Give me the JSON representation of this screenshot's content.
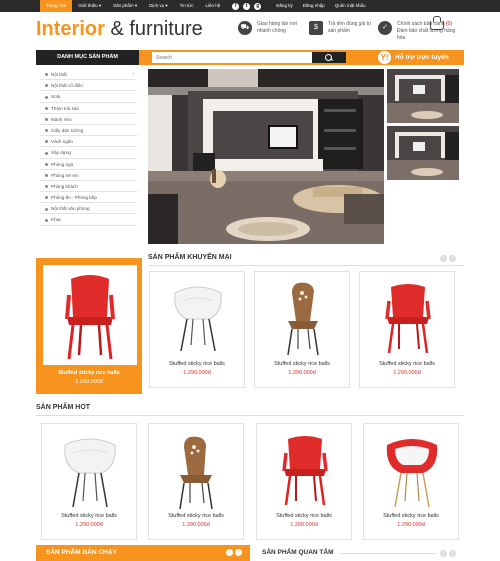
{
  "nav": {
    "items": [
      "Trang chủ",
      "Giới thiệu ▾",
      "Sản phẩm ▾",
      "Dịch vụ ▾",
      "Tin tức",
      "Liên hệ"
    ],
    "social": [
      "f",
      "t",
      "g"
    ],
    "register": "Đăng ký",
    "login": "Đăng nhập",
    "forgot": "Quên mật khẩu"
  },
  "header": {
    "logo_part1": "Interior",
    "logo_part2": "& furniture",
    "features": [
      {
        "icon": "truck-icon",
        "text": "Giao hàng tận nơi nhanh chóng"
      },
      {
        "icon": "cash-icon",
        "text": "Trả tiền đúng giá trị sản phẩm"
      },
      {
        "icon": "warranty-icon",
        "text": "Chính sách bảo hành - Đảm bảo chất lượng hàng hóa"
      }
    ],
    "cart_count": "(0)"
  },
  "toolbar": {
    "category_title": "DANH MỤC SẢN PHẨM",
    "search_placeholder": "Search",
    "support_label": "Hỗ trợ trực tuyến",
    "support_icon": "Y!"
  },
  "sidebar": {
    "items": [
      "Nội thất",
      "Nội thất cổ điển",
      "Sofa",
      "Thảm trải sàn",
      "Mành rèm",
      "Giấy dán tường",
      "Vách ngăn",
      "Xây dựng",
      "Phòng ngủ",
      "Phòng trẻ em",
      "Phòng khách",
      "Phòng ăn - Phòng bếp",
      "Nội thất văn phòng",
      "Khác"
    ]
  },
  "sections": {
    "promo_title": "SẢN PHẨM KHUYẾN MẠI",
    "hot_title": "SẢN PHẨM HOT",
    "bestseller_title": "SẢN PHẨM BÁN CHẠY",
    "interest_title": "SẢN PHẨM QUAN TÂM"
  },
  "promo_products": [
    {
      "name": "Stuffed sticky rice balls",
      "price": "1.290.000đ",
      "chair": "red"
    },
    {
      "name": "Stuffed sticky rice balls",
      "price": "1.290.000đ",
      "chair": "white"
    },
    {
      "name": "Stuffed sticky rice balls",
      "price": "1.290.000đ",
      "chair": "wood"
    },
    {
      "name": "Stuffed sticky rice balls",
      "price": "1.290.000đ",
      "chair": "red"
    }
  ],
  "hot_products": [
    {
      "name": "Stuffed sticky rice balls",
      "price": "1.290.000đ",
      "chair": "white"
    },
    {
      "name": "Stuffed sticky rice balls",
      "price": "1.290.000đ",
      "chair": "wood"
    },
    {
      "name": "Stuffed sticky rice balls",
      "price": "1.290.000đ",
      "chair": "red"
    },
    {
      "name": "Stuffed sticky rice balls",
      "price": "1.290.000đ",
      "chair": "redwhite"
    }
  ],
  "colors": {
    "accent": "#f7941d",
    "dark": "#222222",
    "price": "#e0302a"
  }
}
